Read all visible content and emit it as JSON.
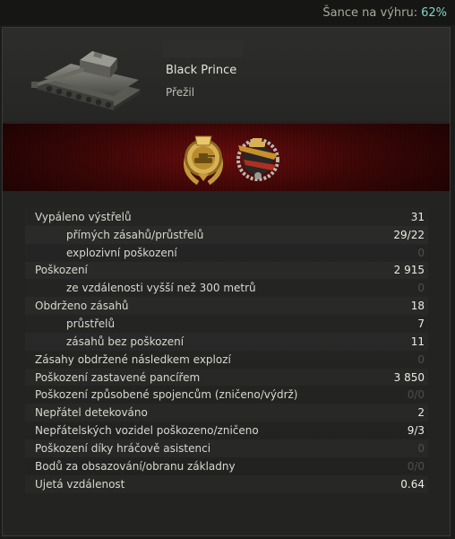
{
  "win_chance": {
    "label": "Šance na výhru:",
    "value": "62%"
  },
  "vehicle": {
    "name": "Black Prince",
    "status": "Přežil",
    "icon": "tank-icon"
  },
  "medals": [
    {
      "icon": "gold-tank-medal-icon"
    },
    {
      "icon": "tank-wreath-badge-icon"
    }
  ],
  "colors": {
    "win_pct": "#7fd4c4",
    "medal_bg": "#5a0a0a",
    "dim_value": "#4e4e4a"
  },
  "stats": [
    {
      "label": "Vypáleno výstřelů",
      "value": "31",
      "sub": false,
      "dim": false
    },
    {
      "label": "přímých zásahů/průstřelů",
      "value": "29/22",
      "sub": true,
      "dim": false
    },
    {
      "label": "explozivní poškození",
      "value": "0",
      "sub": true,
      "dim": true
    },
    {
      "label": "Poškození",
      "value": "2 915",
      "sub": false,
      "dim": false
    },
    {
      "label": "ze vzdálenosti vyšší než 300 metrů",
      "value": "0",
      "sub": true,
      "dim": true
    },
    {
      "label": "Obdrženo zásahů",
      "value": "18",
      "sub": false,
      "dim": false
    },
    {
      "label": "průstřelů",
      "value": "7",
      "sub": true,
      "dim": false
    },
    {
      "label": "zásahů bez poškození",
      "value": "11",
      "sub": true,
      "dim": false
    },
    {
      "label": "Zásahy obdržené následkem explozí",
      "value": "0",
      "sub": false,
      "dim": true
    },
    {
      "label": "Poškození zastavené pancířem",
      "value": "3 850",
      "sub": false,
      "dim": false
    },
    {
      "label": "Poškození způsobené spojencům (zničeno/výdrž)",
      "value": "0/0",
      "sub": false,
      "dim": true
    },
    {
      "label": "Nepřátel detekováno",
      "value": "2",
      "sub": false,
      "dim": false
    },
    {
      "label": "Nepřátelských vozidel poškozeno/zničeno",
      "value": "9/3",
      "sub": false,
      "dim": false
    },
    {
      "label": "Poškození díky hráčově asistenci",
      "value": "0",
      "sub": false,
      "dim": true
    },
    {
      "label": "Bodů za obsazování/obranu základny",
      "value": "0/0",
      "sub": false,
      "dim": true
    },
    {
      "label": "Ujetá vzdálenost",
      "value": "0.64",
      "sub": false,
      "dim": false
    }
  ]
}
